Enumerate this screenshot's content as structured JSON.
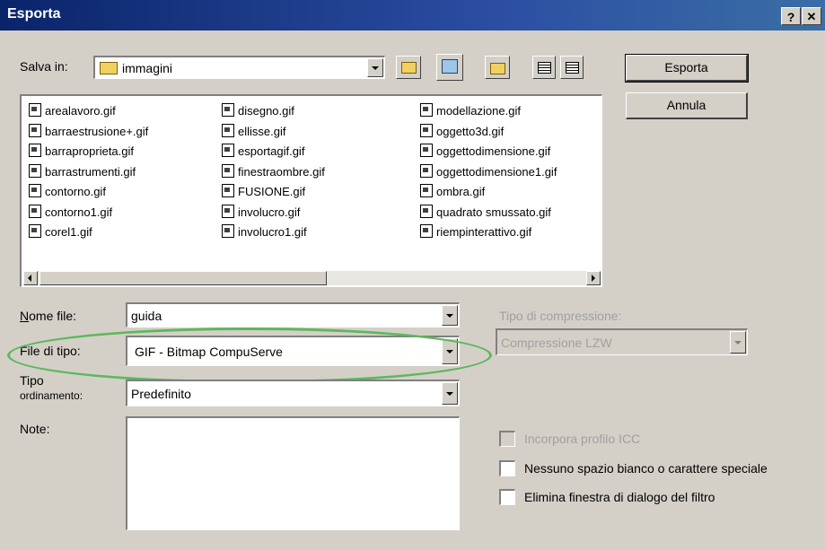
{
  "window": {
    "title": "Esporta"
  },
  "titlebar": {
    "help": "?",
    "close": "✕"
  },
  "save_in": {
    "label": "Salva in:",
    "value": "immagini"
  },
  "buttons": {
    "export": "Esporta",
    "cancel": "Annula"
  },
  "files": [
    [
      "arealavoro.gif",
      "barraestrusione+.gif",
      "barraproprieta.gif",
      "barrastrumenti.gif",
      "contorno.gif",
      "contorno1.gif",
      "corel1.gif"
    ],
    [
      "disegno.gif",
      "ellisse.gif",
      "esportagif.gif",
      "finestraombre.gif",
      "FUSIONE.gif",
      "involucro.gif",
      "involucro1.gif"
    ],
    [
      "modellazione.gif",
      "oggetto3d.gif",
      "oggettodimensione.gif",
      "oggettodimensione1.gif",
      "ombra.gif",
      "quadrato smussato.gif",
      "riempinterattivo.gif"
    ]
  ],
  "filename": {
    "label": "Nome file:",
    "value": "guida"
  },
  "filetype": {
    "label": "File di tipo:",
    "value": "GIF - Bitmap CompuServe"
  },
  "sort": {
    "label_line1": "Tipo",
    "label_line2": "ordinamento:",
    "value": "Predefinito"
  },
  "notes": {
    "label": "Note:"
  },
  "compression": {
    "label": "Tipo di compressione:",
    "value": "Compressione LZW"
  },
  "options": {
    "icc": "Incorpora profilo ICC",
    "no_whitespace": "Nessuno spazio bianco o carattere speciale",
    "filter_dialog": "Elimina finestra di dialogo del filtro"
  },
  "colors": {
    "title_bar": "#0a246a",
    "highlight_oval": "#5cb85c",
    "dialog_bg": "#d4d0c8"
  }
}
